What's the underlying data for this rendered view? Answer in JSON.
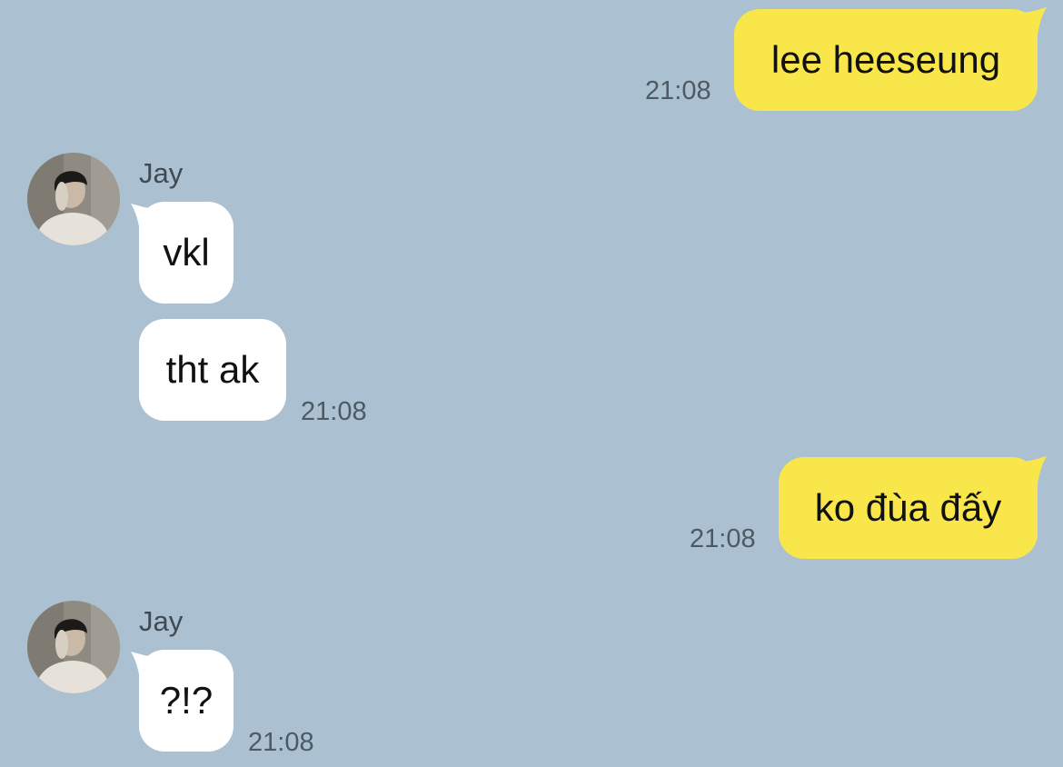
{
  "messages": [
    {
      "sender": "me",
      "text": "lee heeseung",
      "time": "21:08"
    },
    {
      "sender": "Jay",
      "name": "Jay",
      "text": "vkl"
    },
    {
      "sender": "Jay",
      "text": "tht ak",
      "time": "21:08"
    },
    {
      "sender": "me",
      "text": "ko đùa đấy",
      "time": "21:08"
    },
    {
      "sender": "Jay",
      "name": "Jay",
      "text": "?!?",
      "time": "21:08"
    }
  ],
  "icons": {
    "avatar": "person-photo-avatar"
  },
  "colors": {
    "background": "#abc1d1",
    "my_bubble": "#f9e64b",
    "their_bubble": "#ffffff",
    "timestamp": "#4e5a63"
  }
}
